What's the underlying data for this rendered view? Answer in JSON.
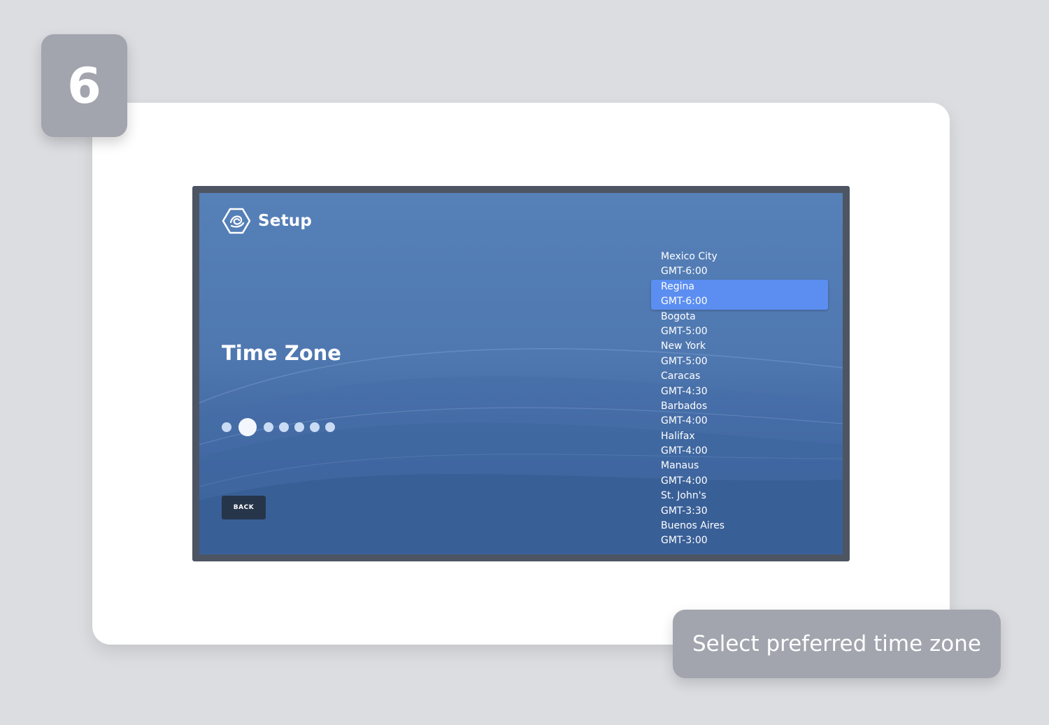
{
  "step": {
    "number": "6"
  },
  "screen": {
    "header_title": "Setup",
    "heading": "Time Zone",
    "progress": {
      "total_steps": 7,
      "current_step": 2
    },
    "back_label": "BACK",
    "timezones": [
      {
        "city": "Mexico City",
        "offset": "GMT-6:00",
        "selected": false
      },
      {
        "city": "Regina",
        "offset": "GMT-6:00",
        "selected": true
      },
      {
        "city": "Bogota",
        "offset": "GMT-5:00",
        "selected": false
      },
      {
        "city": "New York",
        "offset": "GMT-5:00",
        "selected": false
      },
      {
        "city": "Caracas",
        "offset": "GMT-4:30",
        "selected": false
      },
      {
        "city": "Barbados",
        "offset": "GMT-4:00",
        "selected": false
      },
      {
        "city": "Halifax",
        "offset": "GMT-4:00",
        "selected": false
      },
      {
        "city": "Manaus",
        "offset": "GMT-4:00",
        "selected": false
      },
      {
        "city": "St. John's",
        "offset": "GMT-3:30",
        "selected": false
      },
      {
        "city": "Buenos Aires",
        "offset": "GMT-3:00",
        "selected": false
      }
    ]
  },
  "caption": {
    "text": "Select preferred time zone"
  },
  "colors": {
    "page_background": "#dcdde1",
    "badge": "#a2a4ae",
    "screen_blue": "#4f78b0",
    "selection": "#5b8ef0",
    "back_button": "#27354a"
  }
}
